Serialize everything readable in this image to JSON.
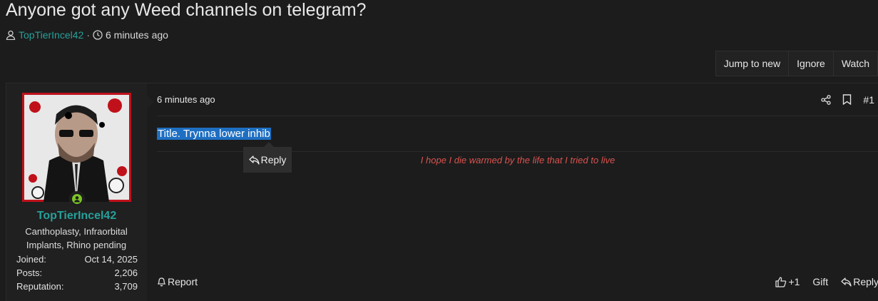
{
  "thread": {
    "title": "Anyone got any Weed channels on telegram?",
    "author": "TopTierIncel42",
    "time": "6 minutes ago",
    "separator": "·"
  },
  "actions": {
    "jump": "Jump to new",
    "ignore": "Ignore",
    "watch": "Watch"
  },
  "post": {
    "date": "6 minutes ago",
    "number": "#1",
    "message": "Title. Trynna lower inhib",
    "quick_reply": "Reply",
    "signature": "I hope I die warmed by the life that I tried to live"
  },
  "user": {
    "name": "TopTierIncel42",
    "title": "Canthoplasty, Infraorbital Implants, Rhino pending",
    "stats": [
      {
        "label": "Joined:",
        "value": "Oct 14, 2025"
      },
      {
        "label": "Posts:",
        "value": "2,206"
      },
      {
        "label": "Reputation:",
        "value": "3,709"
      }
    ]
  },
  "footer": {
    "report": "Report",
    "like": "+1",
    "gift": "Gift",
    "reply": "Reply"
  },
  "colors": {
    "accent": "#27a09a",
    "signature": "#d9534f",
    "selection": "#1e6fc2",
    "online": "#7cc428"
  }
}
